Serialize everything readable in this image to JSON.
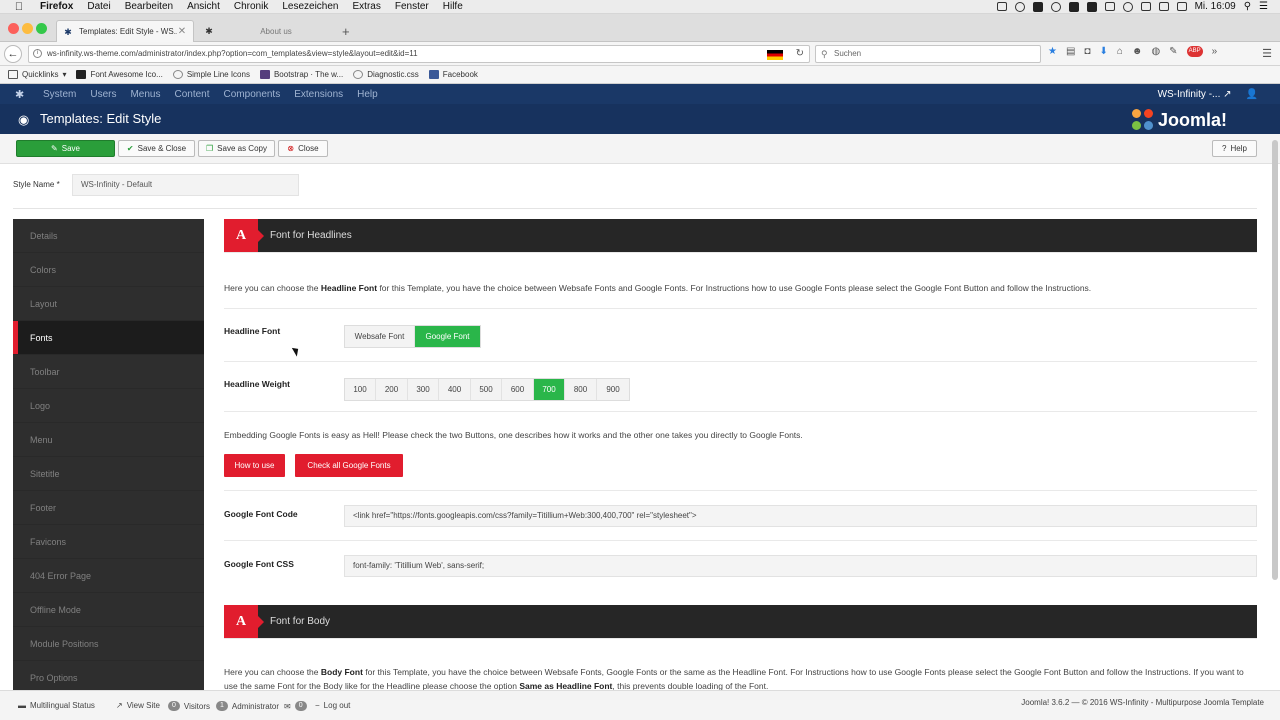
{
  "mac_menubar": {
    "app": "Firefox",
    "items": [
      "Datei",
      "Bearbeiten",
      "Ansicht",
      "Chronik",
      "Lesezeichen",
      "Extras",
      "Fenster",
      "Hilfe"
    ],
    "clock": "Mi. 16:09"
  },
  "tabs": [
    {
      "label": "Templates: Edit Style - WS...",
      "icon": "joomla-icon"
    },
    {
      "label": "About us",
      "icon": "joomla-icon"
    }
  ],
  "nav": {
    "url": "ws-infinity.ws-theme.com/administrator/index.php?option=com_templates&view=style&layout=edit&id=11",
    "search_placeholder": "Suchen"
  },
  "bookmarks": [
    {
      "label": "Quicklinks",
      "color": "#555555"
    },
    {
      "label": "Font Awesome Ico...",
      "color": "#222222"
    },
    {
      "label": "Simple Line Icons",
      "color": "#888888"
    },
    {
      "label": "Bootstrap · The w...",
      "color": "#563d7c"
    },
    {
      "label": "Diagnostic.css",
      "color": "#888888"
    },
    {
      "label": "Facebook",
      "color": "#3b5998"
    }
  ],
  "admin_nav": {
    "items": [
      "System",
      "Users",
      "Menus",
      "Content",
      "Components",
      "Extensions",
      "Help"
    ],
    "site_link": "WS-Infinity -..."
  },
  "header": {
    "title": "Templates: Edit Style",
    "brand": "Joomla!"
  },
  "toolbar": {
    "save": "Save",
    "save_close": "Save & Close",
    "save_copy": "Save as Copy",
    "close": "Close",
    "help": "Help"
  },
  "style_name": {
    "label": "Style Name *",
    "value": "WS-Infinity - Default"
  },
  "sidebar": {
    "items": [
      "Details",
      "Colors",
      "Layout",
      "Fonts",
      "Toolbar",
      "Logo",
      "Menu",
      "Sitetitle",
      "Footer",
      "Favicons",
      "404 Error Page",
      "Offline Mode",
      "Module Positions",
      "Pro Options"
    ],
    "active": "Fonts"
  },
  "headlines": {
    "section_icon": "A",
    "section_title": "Font for Headlines",
    "intro_pre": "Here you can choose the ",
    "intro_bold": "Headline Font",
    "intro_post": " for this Template, you have the choice between Websafe Fonts and Google Fonts. For Instructions how to use Google Fonts please select the Google Font Button and follow the Instructions.",
    "font_label": "Headline Font",
    "font_options": [
      "Websafe Font",
      "Google Font"
    ],
    "font_selected": "Google Font",
    "weight_label": "Headline Weight",
    "weight_options": [
      "100",
      "200",
      "300",
      "400",
      "500",
      "600",
      "700",
      "800",
      "900"
    ],
    "weight_selected": "700",
    "embed_text": "Embedding Google Fonts is easy as Hell! Please check the two Buttons, one describes how it works and the other one takes you directly to Google Fonts.",
    "how_to_use": "How to use",
    "check_fonts": "Check all Google Fonts",
    "code_label": "Google Font Code",
    "code_value": "<link href=\"https://fonts.googleapis.com/css?family=Titillium+Web:300,400,700\" rel=\"stylesheet\">",
    "css_label": "Google Font CSS",
    "css_value": "font-family: 'Titillium Web', sans-serif;"
  },
  "body_font": {
    "section_icon": "A",
    "section_title": "Font for Body",
    "intro_pre": "Here you can choose the ",
    "intro_bold": "Body Font",
    "intro_mid": " for this Template, you have the choice between Websafe Fonts, Google Fonts or the same as the Headline Font. For Instructions how to use Google Fonts please select the Google Font Button and follow the Instructions. If you want to use the same Font for the Body like for the Headline please choose the option ",
    "intro_bold2": "Same as Headline Font",
    "intro_post": ", this prevents double loading of the Font."
  },
  "statusbar": {
    "multilingual": "Multilingual Status",
    "view_site": "View Site",
    "visitors_count": "0",
    "visitors": "Visitors",
    "admin_count": "1",
    "administrator": "Administrator",
    "messages_count": "0",
    "logout": "Log out",
    "copyright": "Joomla! 3.6.2  —  © 2016 WS-Infinity - Multipurpose Joomla Template"
  },
  "colors": {
    "accent_red": "#e11d2e",
    "selected_green": "#2ab64a",
    "save_green": "#2a9e3a",
    "admin_navy": "#1a3867"
  }
}
